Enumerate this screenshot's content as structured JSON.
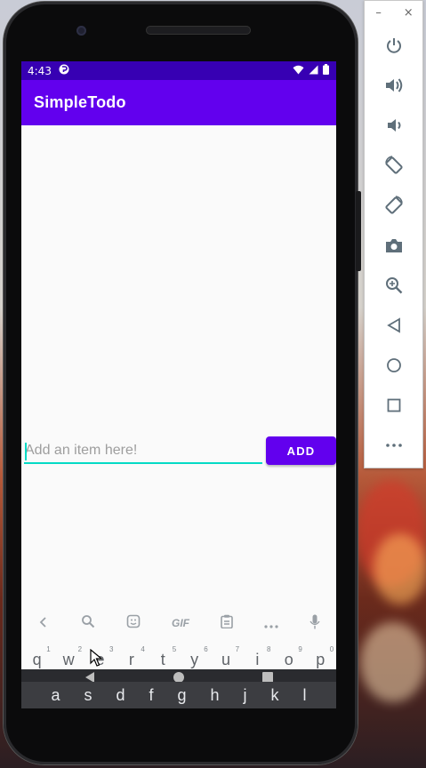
{
  "status_bar": {
    "time": "4:43"
  },
  "app": {
    "title": "SimpleTodo"
  },
  "form": {
    "input_placeholder": "Add an item here!",
    "input_value": "",
    "add_button_label": "ADD"
  },
  "keyboard": {
    "toolbar": [
      "back-arrow-icon",
      "search-icon",
      "sticker-icon",
      "GIF",
      "clipboard-icon",
      "more-icon",
      "mic-icon"
    ],
    "gif_label": "GIF",
    "row1": [
      {
        "key": "q",
        "hint": "1"
      },
      {
        "key": "w",
        "hint": "2"
      },
      {
        "key": "e",
        "hint": "3"
      },
      {
        "key": "r",
        "hint": "4"
      },
      {
        "key": "t",
        "hint": "5"
      },
      {
        "key": "y",
        "hint": "6"
      },
      {
        "key": "u",
        "hint": "7"
      },
      {
        "key": "i",
        "hint": "8"
      },
      {
        "key": "o",
        "hint": "9"
      },
      {
        "key": "p",
        "hint": "0"
      }
    ],
    "row2": [
      "a",
      "s",
      "d",
      "f",
      "g",
      "h",
      "j",
      "k",
      "l"
    ]
  },
  "emulator_panel": {
    "buttons": [
      "power-icon",
      "volume-up-icon",
      "volume-down-icon",
      "rotate-left-icon",
      "rotate-right-icon",
      "camera-icon",
      "zoom-icon",
      "back-icon",
      "home-icon",
      "overview-icon",
      "more-icon"
    ],
    "minimize_label": "–",
    "close_label": "×"
  },
  "colors": {
    "primary": "#6200ee",
    "primary_dark": "#3700b3",
    "accent": "#03dac5"
  }
}
